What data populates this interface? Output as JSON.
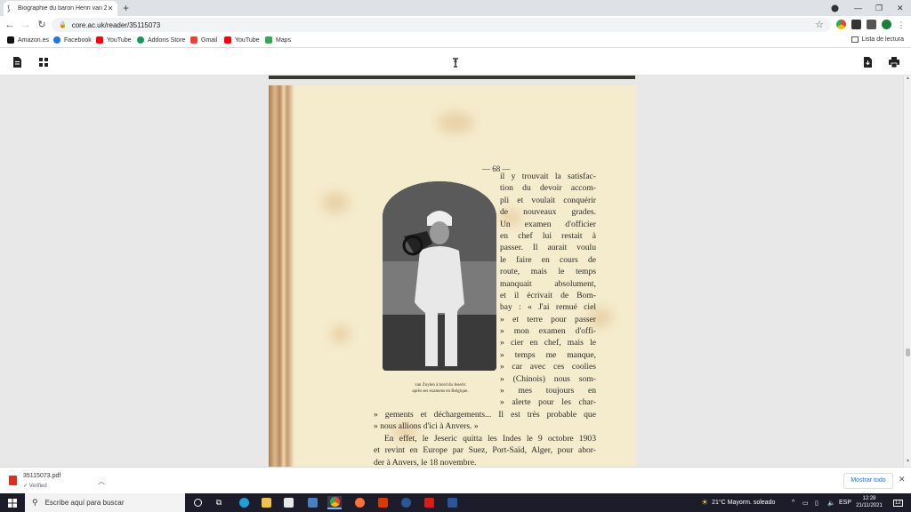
{
  "browser": {
    "tab_title": "Biographie du baron Henri van Z",
    "url": "core.ac.uk/reader/35115073",
    "new_tab": "+",
    "reading_list": "Lista de lectura"
  },
  "bookmarks": [
    {
      "label": "Amazon.es",
      "color": "#111111"
    },
    {
      "label": "Facebook",
      "color": "#1877f2"
    },
    {
      "label": "YouTube",
      "color": "#ff0000"
    },
    {
      "label": "Addons Store",
      "color": "#0f9d58"
    },
    {
      "label": "Gmail",
      "color": "#ea4335"
    },
    {
      "label": "YouTube",
      "color": "#ff0000"
    },
    {
      "label": "Maps",
      "color": "#34a853"
    }
  ],
  "document": {
    "page_number": "— 68 —",
    "caption_line1": "van Zuylen à bord du Jeseric",
    "caption_line2": "après ses examens en Belgique.",
    "column_lines": [
      "il y trouvait la satisfac-",
      "tion du devoir accom-",
      "pli et voulait conquérir",
      "de nouveaux grades.",
      "Un examen d'officier",
      "en chef lui restait à",
      "passer. Il aurait voulu",
      "le faire en cours de",
      "route, mais le temps",
      "manquait absolument,",
      "et il écrivait de Bom-",
      "bay : « J'ai remué ciel",
      "» et terre pour passer",
      "» mon examen d'offi-",
      "» cier en chef, mais le",
      "» temps me manque,",
      "» car avec ces coolies",
      "» (Chinois) nous som-",
      "» mes toujours en",
      "» alerte pour les char-"
    ],
    "full_lines": [
      "» gements et déchargements... Il est très probable que",
      "» nous allions d'ici à Anvers. »",
      "En effet, le Jeseric quitta les Indes le 9 octobre 1903",
      "et revint en Europe par Suez, Port-Saïd, Alger, pour abor-",
      "der à Anvers, le 18 novembre."
    ]
  },
  "download": {
    "filename": "35115073.pdf",
    "status": "Verified",
    "show_all": "Mostrar todo"
  },
  "taskbar": {
    "search_placeholder": "Escribe aquí para buscar",
    "weather": "21°C  Mayorm. soleado",
    "language": "ESP",
    "time": "12:28",
    "date": "21/11/2021",
    "notifications": "12"
  }
}
